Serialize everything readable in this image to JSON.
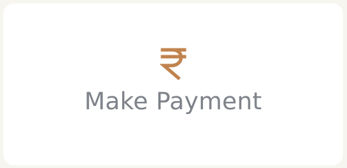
{
  "card": {
    "label": "Make Payment",
    "icon": "rupee-icon",
    "icon_color": "#c1834e",
    "label_color": "#7e8289"
  }
}
